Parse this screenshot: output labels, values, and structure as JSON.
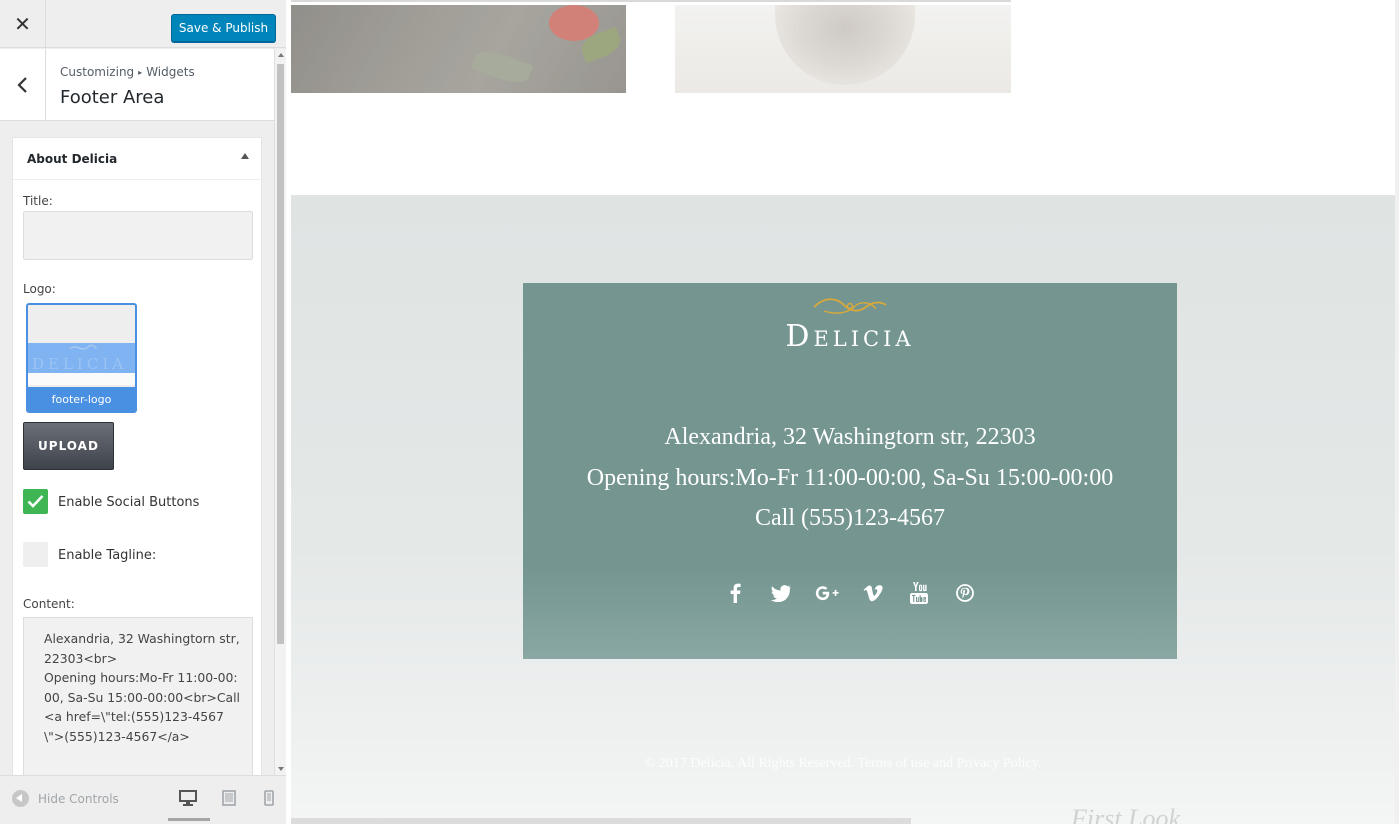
{
  "topbar": {
    "close_icon": "close-icon",
    "save_label": "Save & Publish",
    "accent": "#0085ba"
  },
  "section": {
    "breadcrumb_root": "Customizing",
    "breadcrumb_child": "Widgets",
    "title": "Footer Area"
  },
  "widget": {
    "title": "About Delicia",
    "fields": {
      "title_label": "Title:",
      "title_value": "",
      "logo_label": "Logo:",
      "logo_caption": "footer-logo",
      "upload_label": "UPLOAD",
      "social_label": "Enable Social Buttons",
      "social_checked": true,
      "tagline_label": "Enable Tagline:",
      "tagline_checked": false,
      "content_label": "Content:",
      "content_value": "Alexandria, 32 Washingtorn str, 22303<br>\nOpening hours:Mo-Fr 11:00-00:00, Sa-Su 15:00-00:00<br>Call <a href=\\\"tel:(555)123-4567\\\">(555)123-4567</a>"
    }
  },
  "bottom_bar": {
    "hide_controls": "Hide Controls",
    "devices": [
      "desktop-icon",
      "tablet-icon",
      "mobile-icon"
    ],
    "active_device": "desktop"
  },
  "preview": {
    "logo_text": "Delicia",
    "address": "Alexandria, 32 Washingtorn str, 22303",
    "hours": "Opening hours:Mo-Fr 11:00-00:00, Sa-Su 15:00-00:00",
    "call": "Call (555)123-4567",
    "social_icons": [
      "facebook-icon",
      "twitter-icon",
      "google-plus-icon",
      "vimeo-icon",
      "youtube-icon",
      "pinterest-icon"
    ],
    "copyright_prefix": "© 2017 Delicia. All Rights Reserved. ",
    "terms_link": "Terms of use",
    "and_text": " and ",
    "privacy_link": "Privacy Policy",
    "copyright_suffix": ".",
    "footer_card_color": "#749590",
    "logo_accent": "#d9a93a"
  }
}
